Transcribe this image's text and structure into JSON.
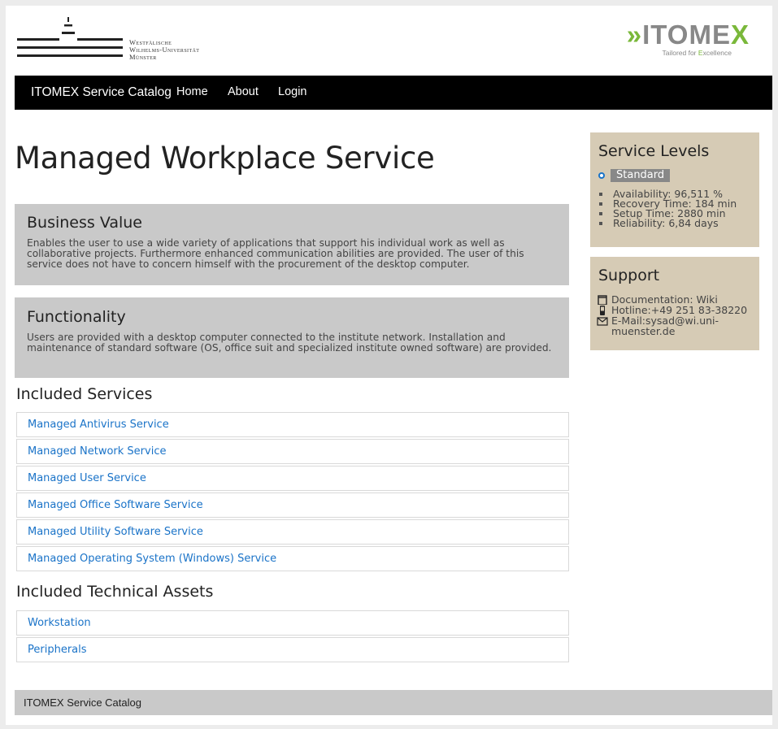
{
  "header": {
    "university": {
      "line1": "Westfälische",
      "line2": "Wilhelms-Universität",
      "line3": "Münster"
    },
    "brand_logo": {
      "word_main": "ITOME",
      "word_accent": "X",
      "prefix": "»",
      "tagline_a": "Tailored for ",
      "tagline_accent": "E",
      "tagline_b": "xcellence",
      "accent_color": "#7ab83a",
      "word_color": "#888888"
    }
  },
  "nav": {
    "brand": "ITOMEX Service Catalog",
    "links": [
      "Home",
      "About",
      "Login"
    ]
  },
  "main": {
    "title": "Managed Workplace Service",
    "business_value": {
      "heading": "Business Value",
      "text": "Enables the user to use a wide variety of applications that support his individual work as well as collaborative projects. Furthermore enhanced communication abilities are provided. The user of this service does not have to concern himself with the procurement of the desktop computer."
    },
    "functionality": {
      "heading": "Functionality",
      "text": "Users are provided with a desktop computer connected to the institute network. Installation and maintenance of standard software (OS, office suit and specialized institute owned software) are provided."
    },
    "included_services": {
      "heading": "Included Services",
      "items": [
        "Managed Antivirus Service",
        "Managed Network Service",
        "Managed User Service",
        "Managed Office Software Service",
        "Managed Utility Software Service",
        "Managed Operating System (Windows) Service"
      ]
    },
    "included_assets": {
      "heading": "Included Technical Assets",
      "items": [
        "Workstation",
        "Peripherals"
      ]
    }
  },
  "sidebar": {
    "service_levels": {
      "heading": "Service Levels",
      "selected_level": "Standard",
      "metrics": [
        "Availability: 96,511 %",
        "Recovery Time: 184 min",
        "Setup Time: 2880 min",
        "Reliability: 6,84 days"
      ]
    },
    "support": {
      "heading": "Support",
      "documentation": "Documentation: Wiki",
      "hotline": "Hotline:+49 251 83-38220",
      "email": "E-Mail:sysad@wi.uni-muenster.de"
    }
  },
  "footer": {
    "text": "ITOMEX Service Catalog"
  },
  "colors": {
    "link": "#1a73c8",
    "panel_gray": "#c9c9c9",
    "panel_beige": "#d6cbb5",
    "navbar": "#000000"
  }
}
